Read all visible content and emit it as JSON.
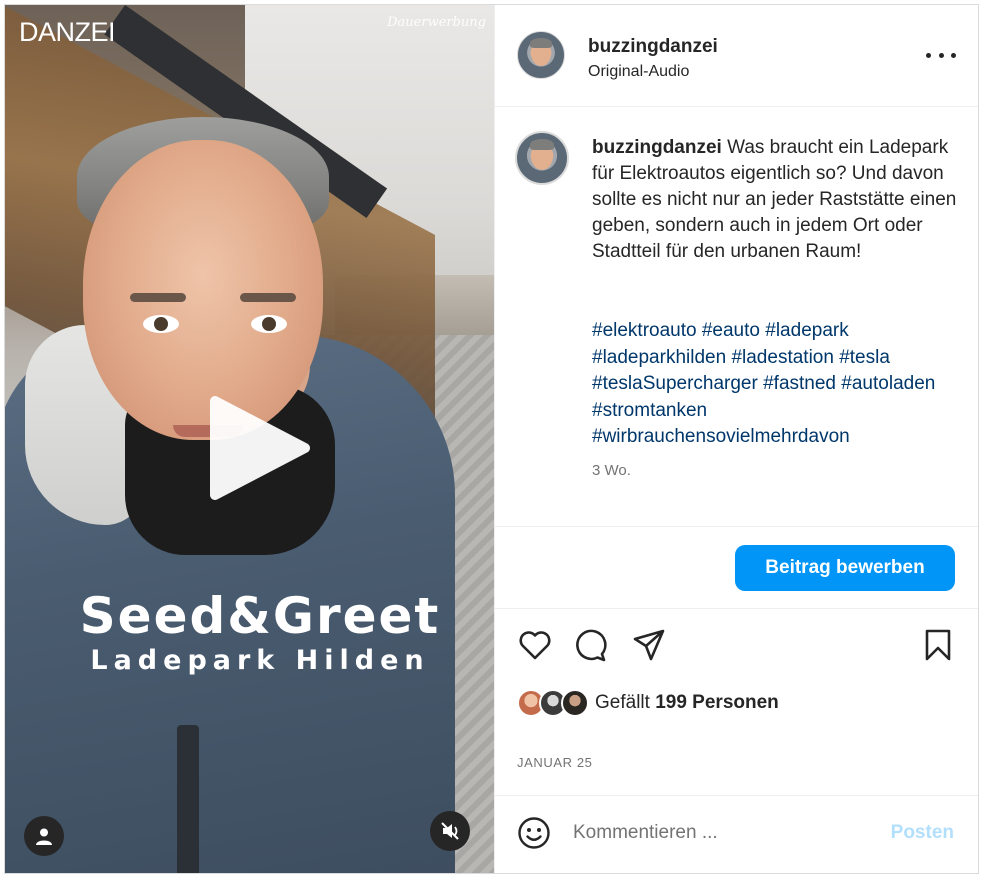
{
  "media": {
    "brand": "DANZEI",
    "ad_label": "Dauerwerbung",
    "overlay_title": "Seed&Greet",
    "overlay_subtitle": "Ladepark Hilden"
  },
  "header": {
    "username": "buzzingdanzei",
    "audio": "Original-Audio"
  },
  "caption": {
    "username": "buzzingdanzei",
    "text": "Was braucht ein Ladepark für Elektroautos eigentlich so? Und davon sollte es nicht nur an jeder Raststätte einen geben, sondern auch in jedem Ort oder Stadtteil für den urbanen Raum!",
    "hashtags": [
      "#elektroauto",
      "#eauto",
      "#ladepark",
      "#ladeparkhilden",
      "#ladestation",
      "#tesla",
      "#teslaSupercharger",
      "#fastned",
      "#autoladen",
      "#stromtanken",
      "#wirbrauchensovielmehrdavon"
    ],
    "age": "3 Wo."
  },
  "promote": {
    "label": "Beitrag bewerben"
  },
  "likes": {
    "prefix": "Gefällt",
    "count": "199 Personen"
  },
  "date": "JANUAR 25",
  "comment": {
    "placeholder": "Kommentieren ...",
    "post_label": "Posten"
  },
  "icons": {
    "more": "more-options-icon",
    "heart": "heart-icon",
    "comment": "comment-icon",
    "share": "share-icon",
    "bookmark": "bookmark-icon",
    "emoji": "emoji-icon",
    "play": "play-icon",
    "user": "user-tags-icon",
    "mute": "muted-speaker-icon"
  },
  "colors": {
    "accent": "#0095f6",
    "hashtag": "#00376b",
    "post_disabled": "#b2dffc"
  }
}
